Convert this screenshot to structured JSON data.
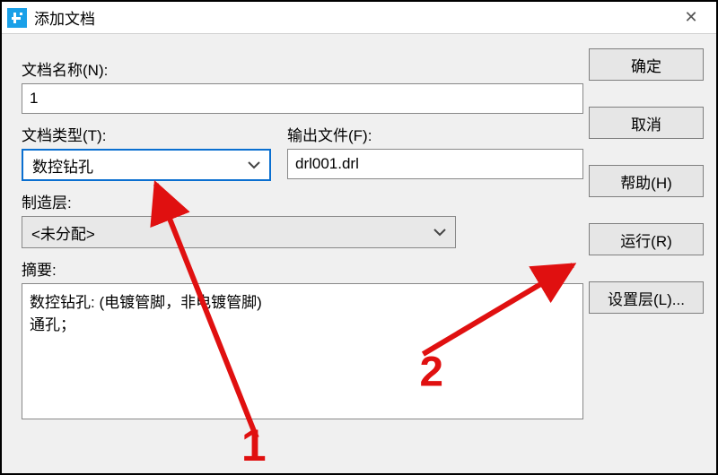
{
  "window": {
    "title": "添加文档",
    "close_glyph": "✕"
  },
  "labels": {
    "doc_name": "文档名称(N):",
    "doc_type": "文档类型(T):",
    "output_file": "输出文件(F):",
    "mfg_layer": "制造层:",
    "summary": "摘要:"
  },
  "fields": {
    "doc_name_value": "1",
    "doc_type_value": "数控钻孔",
    "output_file_value": "drl001.drl",
    "mfg_layer_value": "<未分配>",
    "summary_value": "数控钻孔: (电镀管脚，非电镀管脚)\n通孔；"
  },
  "buttons": {
    "ok": "确定",
    "cancel": "取消",
    "help": "帮助(H)",
    "run": "运行(R)",
    "set_layers": "设置层(L)..."
  },
  "annotations": {
    "one": "1",
    "two": "2"
  }
}
